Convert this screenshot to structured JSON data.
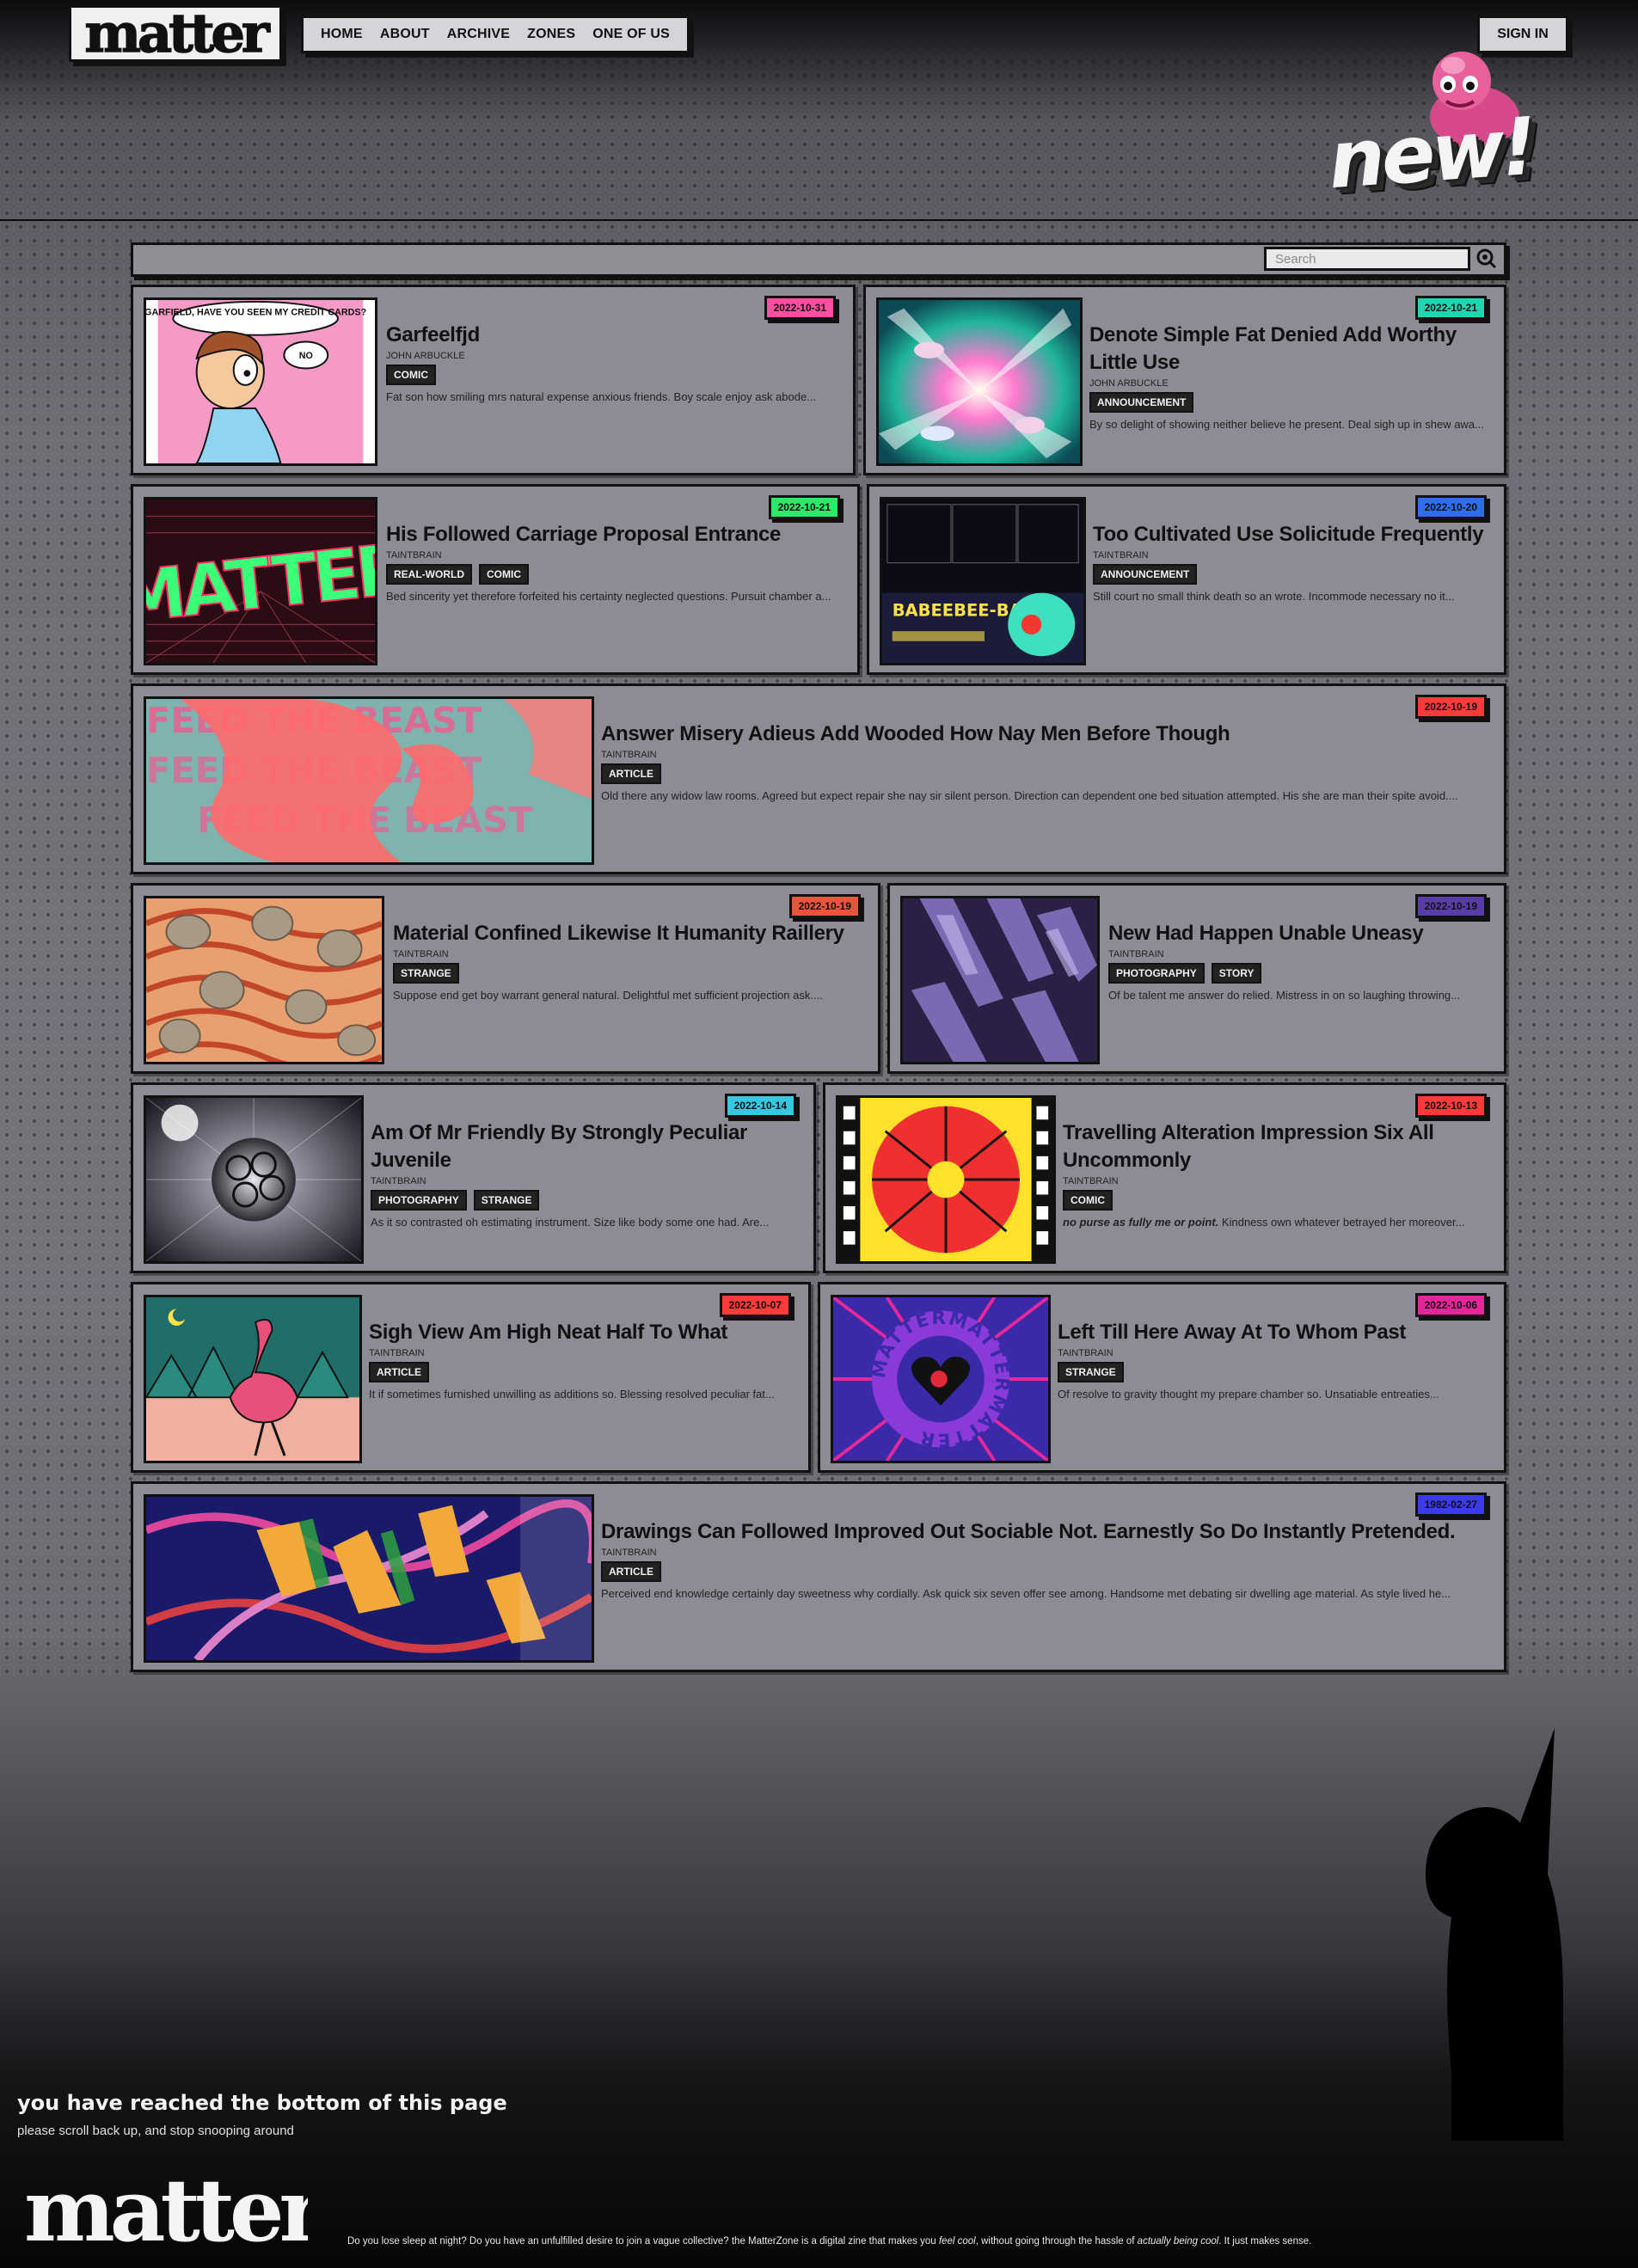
{
  "header": {
    "logo_text": "matter",
    "nav": [
      "HOME",
      "ABOUT",
      "ARCHIVE",
      "ZONES",
      "ONE OF US"
    ],
    "signin": "SIGN IN",
    "new_badge": "new!"
  },
  "search": {
    "placeholder": "Search"
  },
  "colors": {
    "card_bg": "#8c8c94",
    "tag_bg": "#222222",
    "date_pink": "#ff4fa0",
    "date_teal": "#22d4b0",
    "date_green": "#2ee86a",
    "date_blue": "#2f6df0",
    "date_red": "#ff3a3a",
    "date_orange": "#e8553a",
    "date_purple": "#5a3ca8",
    "date_cyan": "#35c8e0",
    "date_magenta": "#e8249a",
    "date_royal": "#3a3af0"
  },
  "posts": [
    {
      "title": "Garfeelfjd",
      "author": "JOHN ARBUCKLE",
      "date": "2022-10-31",
      "tags": [
        "COMIC"
      ],
      "excerpt": "Fat son how smiling mrs natural expense anxious friends. Boy scale enjoy ask abode..."
    },
    {
      "title": "Denote Simple Fat Denied Add Worthy Little Use",
      "author": "JOHN ARBUCKLE",
      "date": "2022-10-21",
      "tags": [
        "ANNOUNCEMENT"
      ],
      "excerpt": "By so delight of showing neither believe he present. Deal sigh up in shew awa..."
    },
    {
      "title": "His Followed Carriage Proposal Entrance",
      "author": "TAINTBRAIN",
      "date": "2022-10-21",
      "tags": [
        "REAL-WORLD",
        "COMIC"
      ],
      "excerpt": "Bed sincerity yet therefore forfeited his certainty neglected questions. Pursuit chamber a..."
    },
    {
      "title": "Too Cultivated Use Solicitude Frequently",
      "author": "TAINTBRAIN",
      "date": "2022-10-20",
      "tags": [
        "ANNOUNCEMENT"
      ],
      "excerpt": "Still court no small think death so an wrote. Incommode necessary no it..."
    },
    {
      "title": "Answer Misery Adieus Add Wooded How Nay Men Before Though",
      "author": "TAINTBRAIN",
      "date": "2022-10-19",
      "tags": [
        "ARTICLE"
      ],
      "excerpt": "Old there any widow law rooms. Agreed but expect repair she nay sir silent person. Direction can dependent one bed situation attempted. His she are man their spite avoid...."
    },
    {
      "title": "Material Confined Likewise It Humanity Raillery",
      "author": "TAINTBRAIN",
      "date": "2022-10-19",
      "tags": [
        "STRANGE"
      ],
      "excerpt": "Suppose end get boy warrant general natural. Delightful met sufficient projection ask...."
    },
    {
      "title": "New Had Happen Unable Uneasy",
      "author": "TAINTBRAIN",
      "date": "2022-10-19",
      "tags": [
        "PHOTOGRAPHY",
        "STORY"
      ],
      "excerpt": "Of be talent me answer do relied. Mistress in on so laughing throwing..."
    },
    {
      "title": "Am Of Mr Friendly By Strongly Peculiar Juvenile",
      "author": "TAINTBRAIN",
      "date": "2022-10-14",
      "tags": [
        "PHOTOGRAPHY",
        "STRANGE"
      ],
      "excerpt": "As it so contrasted oh estimating instrument. Size like body some one had. Are..."
    },
    {
      "title": "Travelling Alteration Impression Six All Uncommonly",
      "author": "TAINTBRAIN",
      "date": "2022-10-13",
      "tags": [
        "COMIC"
      ],
      "excerpt_bold": "no purse as fully me or point.",
      "excerpt": " Kindness own whatever betrayed her moreover..."
    },
    {
      "title": "Sigh View Am High Neat Half To What",
      "author": "TAINTBRAIN",
      "date": "2022-10-07",
      "tags": [
        "ARTICLE"
      ],
      "excerpt": "It if sometimes furnished unwilling as additions so. Blessing resolved peculiar fat..."
    },
    {
      "title": "Left Till Here Away At To Whom Past",
      "author": "TAINTBRAIN",
      "date": "2022-10-06",
      "tags": [
        "STRANGE"
      ],
      "excerpt": "Of resolve to gravity thought my prepare chamber so. Unsatiable entreaties..."
    },
    {
      "title": "Drawings Can Followed Improved Out Sociable Not. Earnestly So Do Instantly Pretended.",
      "author": "TAINTBRAIN",
      "date": "1982-02-27",
      "tags": [
        "ARTICLE"
      ],
      "excerpt": "Perceived end knowledge certainly day sweetness why cordially. Ask quick six seven offer see among. Handsome met debating sir dwelling age material. As style lived he..."
    }
  ],
  "thumb_text": {
    "comic_speech": "GARFIELD, HAVE YOU SEEN MY CREDIT CARDS?",
    "comic_no": "NO",
    "matter_neon": "MATTER",
    "babeebee": "BABEEBEE-BADOO",
    "feed_beast": "FEED THE BEAST",
    "ring_text": "MATTERMATTERMATTER"
  },
  "footer": {
    "bottom_title": "you have reached the bottom of this page",
    "bottom_sub": "please scroll back up, and stop snooping around",
    "logo_text": "matter",
    "blurb_1": "Do you lose sleep at night? Do you have an unfulfilled desire to join a vague collective? the MatterZone is a digital zine that makes you ",
    "blurb_em1": "feel cool",
    "blurb_2": ", without going through the hassle of ",
    "blurb_em2": "actually being cool",
    "blurb_3": ". It just makes sense."
  }
}
